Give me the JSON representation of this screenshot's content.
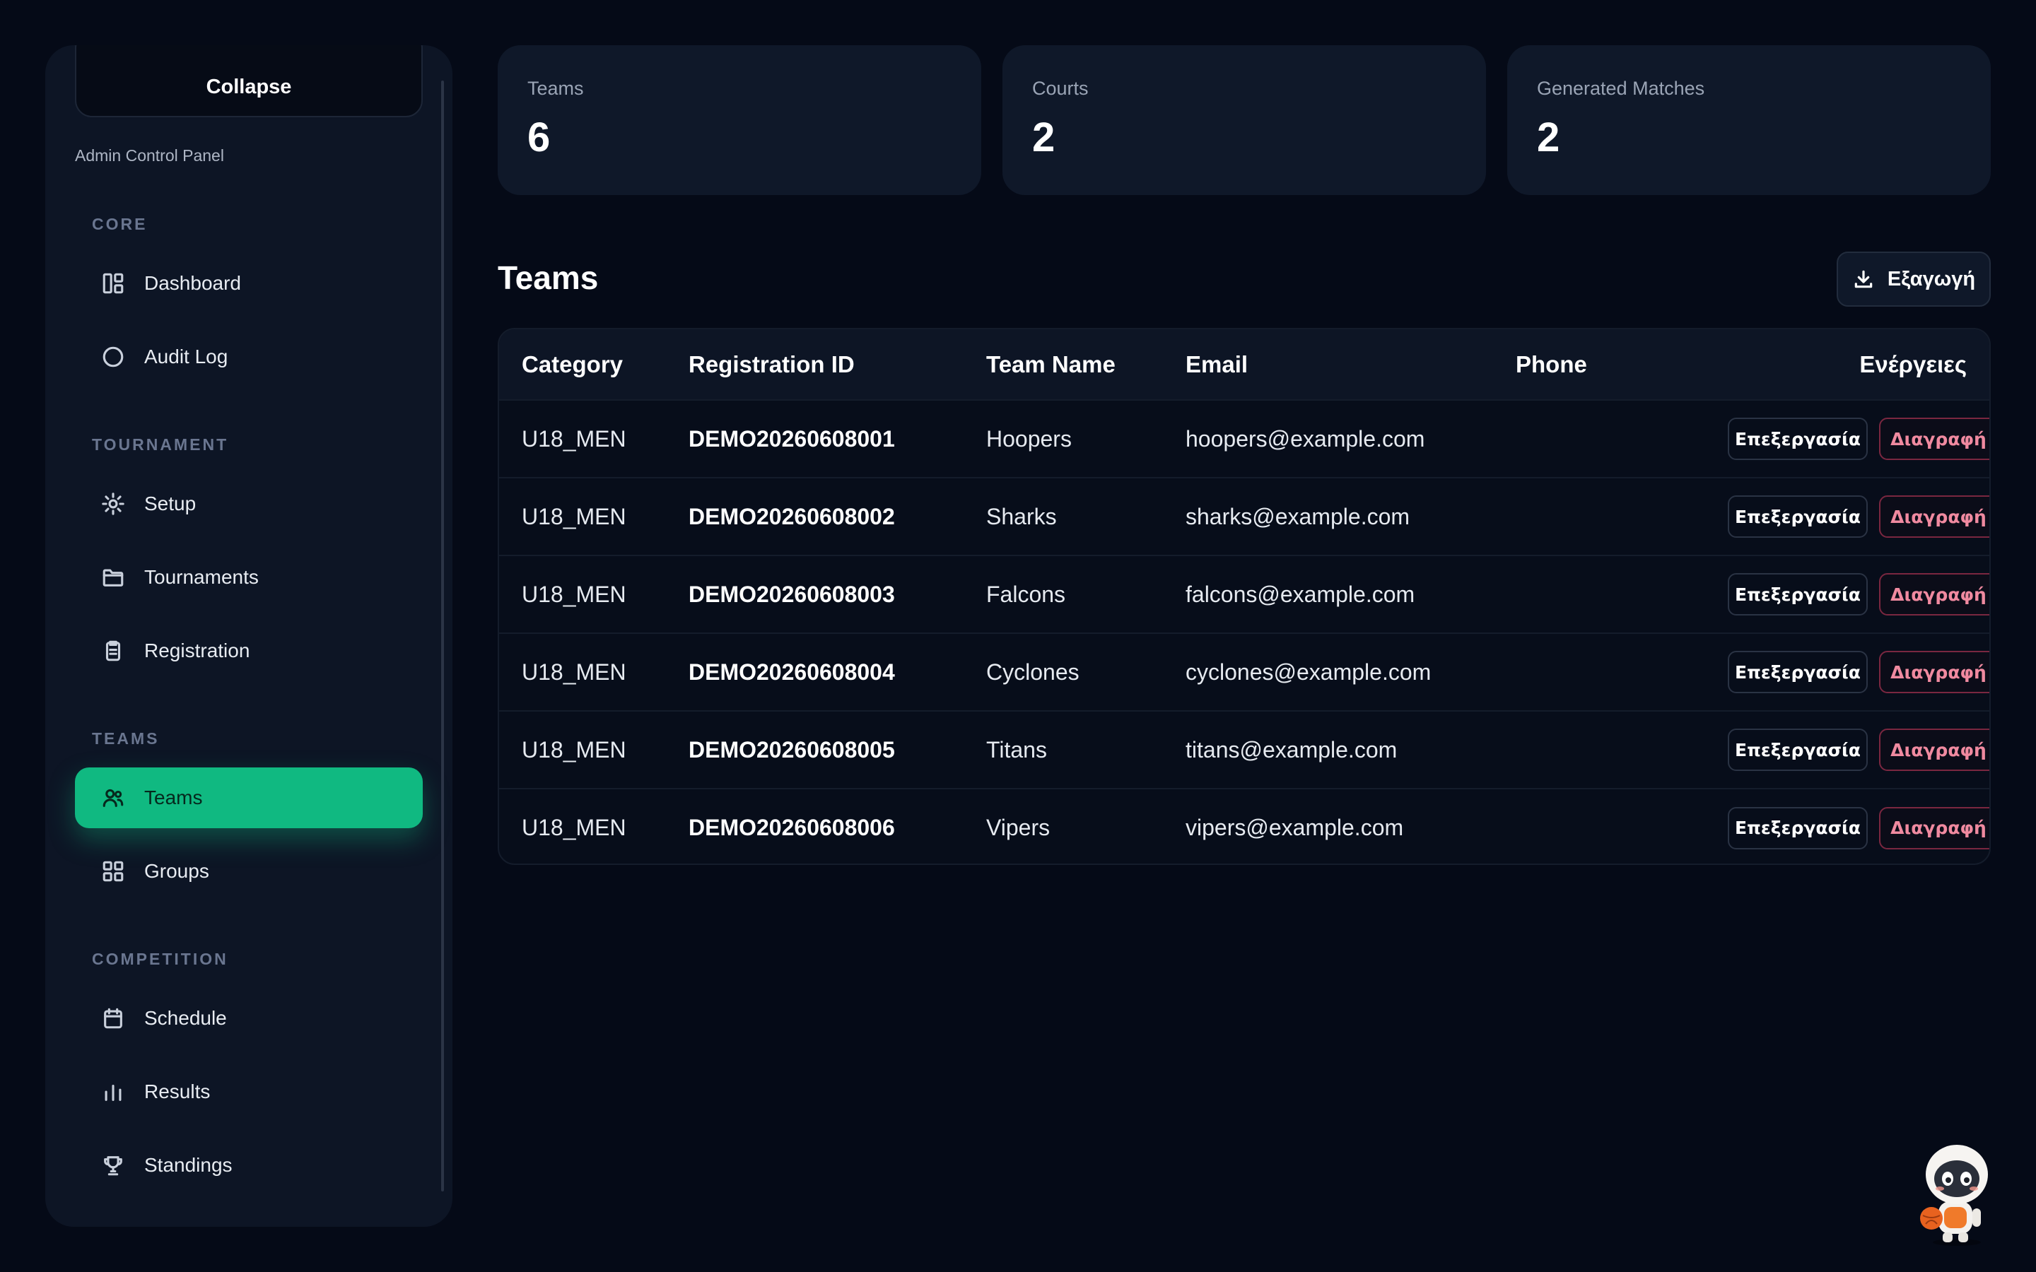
{
  "sidebar": {
    "collapse_label": "Collapse",
    "panel_label": "Admin Control Panel",
    "sections": {
      "core": "CORE",
      "tournament": "TOURNAMENT",
      "teams": "TEAMS",
      "competition": "COMPETITION"
    },
    "items": {
      "dashboard": "Dashboard",
      "audit_log": "Audit Log",
      "setup": "Setup",
      "tournaments": "Tournaments",
      "registration": "Registration",
      "teams": "Teams",
      "groups": "Groups",
      "schedule": "Schedule",
      "results": "Results",
      "standings": "Standings"
    },
    "active_item": "Teams"
  },
  "stats": [
    {
      "label": "Teams",
      "value": "6"
    },
    {
      "label": "Courts",
      "value": "2"
    },
    {
      "label": "Generated Matches",
      "value": "2"
    }
  ],
  "main": {
    "title": "Teams",
    "export_label": "Εξαγωγή"
  },
  "table": {
    "columns": [
      "Category",
      "Registration ID",
      "Team Name",
      "Email",
      "Phone",
      "Ενέργειες"
    ],
    "edit_label": "Επεξεργασία",
    "delete_label": "Διαγραφή",
    "rows": [
      {
        "category": "U18_MEN",
        "reg_id": "DEMO20260608001",
        "team": "Hoopers",
        "email": "hoopers@example.com",
        "phone": ""
      },
      {
        "category": "U18_MEN",
        "reg_id": "DEMO20260608002",
        "team": "Sharks",
        "email": "sharks@example.com",
        "phone": ""
      },
      {
        "category": "U18_MEN",
        "reg_id": "DEMO20260608003",
        "team": "Falcons",
        "email": "falcons@example.com",
        "phone": ""
      },
      {
        "category": "U18_MEN",
        "reg_id": "DEMO20260608004",
        "team": "Cyclones",
        "email": "cyclones@example.com",
        "phone": ""
      },
      {
        "category": "U18_MEN",
        "reg_id": "DEMO20260608005",
        "team": "Titans",
        "email": "titans@example.com",
        "phone": ""
      },
      {
        "category": "U18_MEN",
        "reg_id": "DEMO20260608006",
        "team": "Vipers",
        "email": "vipers@example.com",
        "phone": ""
      }
    ]
  },
  "colors": {
    "background": "#050a17",
    "panel": "#0d1525",
    "accent": "#10b981",
    "danger": "#f08aa0"
  },
  "icons": {
    "dashboard": "layout-icon",
    "audit_log": "circle-icon",
    "setup": "sun-icon",
    "tournaments": "folder-icon",
    "registration": "clipboard-icon",
    "teams": "users-icon",
    "groups": "grid-icon",
    "schedule": "calendar-icon",
    "results": "bar-chart-icon",
    "standings": "trophy-icon",
    "export": "download-icon",
    "assistant": "robot-mascot"
  }
}
